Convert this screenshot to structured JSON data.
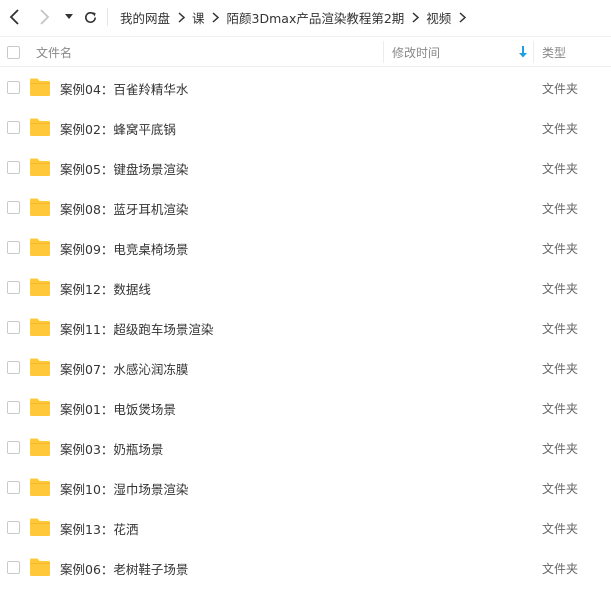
{
  "nav": {
    "back_icon": "chevron-left-icon",
    "forward_icon": "chevron-right-icon",
    "menu_icon": "caret-down-icon",
    "refresh_icon": "refresh-icon"
  },
  "breadcrumb": [
    "我的网盘",
    "课",
    "陌颜3Dmax产品渲染教程第2期",
    "视频"
  ],
  "columns": {
    "name": "文件名",
    "modified": "修改时间",
    "type": "类型"
  },
  "sort": {
    "column": "modified",
    "direction": "desc",
    "color": "#1e9fe5"
  },
  "folder_color": "#ffc73a",
  "files": [
    {
      "name": "案例04：百雀羚精华水",
      "modified": "",
      "type": "文件夹"
    },
    {
      "name": "案例02：蜂窝平底锅",
      "modified": "",
      "type": "文件夹"
    },
    {
      "name": "案例05：键盘场景渲染",
      "modified": "",
      "type": "文件夹"
    },
    {
      "name": "案例08：蓝牙耳机渲染",
      "modified": "",
      "type": "文件夹"
    },
    {
      "name": "案例09：电竞桌椅场景",
      "modified": "",
      "type": "文件夹"
    },
    {
      "name": "案例12：数据线",
      "modified": "",
      "type": "文件夹"
    },
    {
      "name": "案例11：超级跑车场景渲染",
      "modified": "",
      "type": "文件夹"
    },
    {
      "name": "案例07：水感沁润冻膜",
      "modified": "",
      "type": "文件夹"
    },
    {
      "name": "案例01：电饭煲场景",
      "modified": "",
      "type": "文件夹"
    },
    {
      "name": "案例03：奶瓶场景",
      "modified": "",
      "type": "文件夹"
    },
    {
      "name": "案例10：湿巾场景渲染",
      "modified": "",
      "type": "文件夹"
    },
    {
      "name": "案例13：花洒",
      "modified": "",
      "type": "文件夹"
    },
    {
      "name": "案例06：老树鞋子场景",
      "modified": "",
      "type": "文件夹"
    }
  ]
}
